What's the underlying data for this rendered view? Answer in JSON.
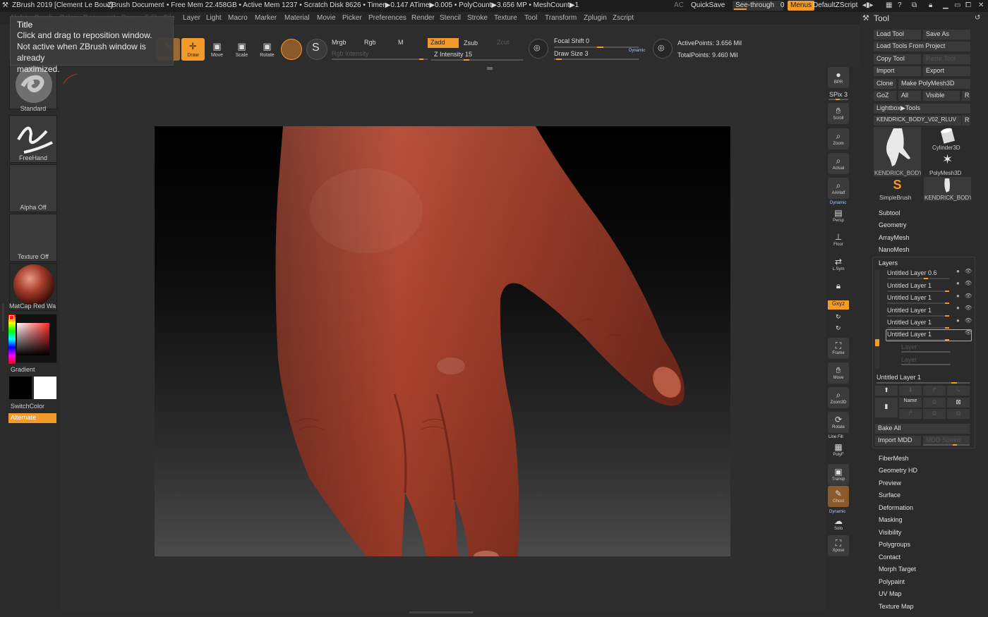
{
  "titlebar": {
    "app_title": "ZBrush 2019 [Clement Le Bouc]",
    "document": "ZBrush Document",
    "stats": "• Free Mem 22.458GB • Active Mem 1237 • Scratch Disk 8626 • Timer▶0.147 ATime▶0.005 • PolyCount▶3.656 MP • MeshCount▶1",
    "ac": "AC",
    "quicksave": "QuickSave",
    "see_through": "See-through",
    "see_through_value": "0",
    "menus": "Menus",
    "script": "DefaultZScript"
  },
  "menubar": [
    "Alpha",
    "Brush",
    "Color",
    "Document",
    "Draw",
    "Edit",
    "File",
    "Layer",
    "Light",
    "Macro",
    "Marker",
    "Material",
    "Movie",
    "Picker",
    "Preferences",
    "Render",
    "Stencil",
    "Stroke",
    "Texture",
    "Tool",
    "Transform",
    "Zplugin",
    "Zscript"
  ],
  "tooltip": {
    "title": "Title",
    "line1": "Click and drag to reposition window.",
    "line2": "Not active when ZBrush window is already",
    "line3": "maximized."
  },
  "shelf": {
    "draw": "Draw",
    "move": "Move",
    "scale": "Scale",
    "rotate": "Rotate",
    "mrgb": "Mrgb",
    "rgb": "Rgb",
    "m": "M",
    "zadd": "Zadd",
    "zsub": "Zsub",
    "zcut": "Zcut",
    "rgb_intensity": "Rgb Intensity",
    "z_intensity": "Z Intensity 15",
    "focal_shift": "Focal Shift 0",
    "draw_size": "Draw Size 3",
    "dynamic": "Dynamic",
    "active_points": "ActivePoints: 3.656 Mil",
    "total_points": "TotalPoints: 9.460 Mil"
  },
  "left": {
    "brush": "Standard",
    "stroke": "FreeHand",
    "alpha": "Alpha Off",
    "texture": "Texture Off",
    "material": "MatCap Red Wa",
    "gradient": "Gradient",
    "switch_color": "SwitchColor",
    "alternate": "Alternate"
  },
  "rightbar": {
    "bpr": "BPR",
    "spix": "SPix 3",
    "scroll": "Scroll",
    "zoom": "Zoom",
    "actual": "Actual",
    "aahalf": "AAHalf",
    "dynamic": "Dynamic",
    "persp": "Persp",
    "floor": "Floor",
    "lsym": "L.Sym",
    "xyz": "Gxyz",
    "frame": "Frame",
    "move": "Move",
    "zoom3d": "Zoom3D",
    "rotate": "Rotate",
    "line_fill": "Line Fill",
    "polyf": "PolyF",
    "transp": "Transp",
    "ghost": "Ghost",
    "solo": "Solo",
    "xpose": "Xpose"
  },
  "tool": {
    "header": "Tool",
    "load_tool": "Load Tool",
    "save_as": "Save As",
    "load_from_project": "Load Tools From Project",
    "copy_tool": "Copy Tool",
    "paste_tool": "Paste Tool",
    "import": "Import",
    "export": "Export",
    "clone": "Clone",
    "make_polymesh": "Make PolyMesh3D",
    "goz": "GoZ",
    "all": "All",
    "visible": "Visible",
    "r": "R",
    "lightbox": "Lightbox▶Tools",
    "current_tool": "KENDRICK_BODY_V02_RLUV",
    "thumbs": [
      "KENDRICK_BODY",
      "Cylinder3D",
      "PolyMesh3D",
      "SimpleBrush",
      "KENDRICK_BODY"
    ],
    "sections_top": [
      "Subtool",
      "Geometry",
      "ArrayMesh",
      "NanoMesh"
    ],
    "layers_title": "Layers",
    "layers": [
      {
        "name": "Untitled Layer",
        "value": "0.6"
      },
      {
        "name": "Untitled Layer",
        "value": "1"
      },
      {
        "name": "Untitled Layer",
        "value": "1"
      },
      {
        "name": "Untitled Layer",
        "value": "1"
      },
      {
        "name": "Untitled Layer",
        "value": "1"
      },
      {
        "name": "Untitled Layer",
        "value": "1"
      }
    ],
    "layer_placeholder": "Layer",
    "current_layer": "Untitled Layer 1",
    "name_btn": "Name",
    "bake_all": "Bake All",
    "import_mdd": "Import MDD",
    "mdd_speed": "MDD Speed",
    "sections_bottom": [
      "FiberMesh",
      "Geometry HD",
      "Preview",
      "Surface",
      "Deformation",
      "Masking",
      "Visibility",
      "Polygroups",
      "Contact",
      "Morph Target",
      "Polypaint",
      "UV Map",
      "Texture Map"
    ]
  },
  "colors": {
    "accent": "#f29b2a",
    "panel": "#2b2b2b",
    "skin": "#a8442f"
  }
}
